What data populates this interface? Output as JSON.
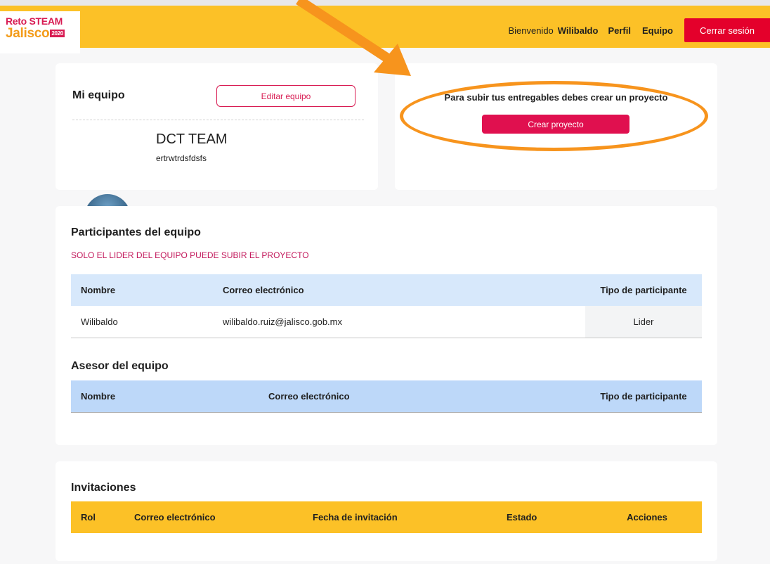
{
  "header": {
    "logo_line1": "Reto STEAM",
    "logo_line2": "Jalisco",
    "logo_year": "2020",
    "welcome_label": "Bienvenido",
    "user_name": "Wilibaldo",
    "nav_profile": "Perfil",
    "nav_team": "Equipo",
    "logout_label": "Cerrar sesión"
  },
  "team_card": {
    "title": "Mi equipo",
    "edit_button": "Editar equipo",
    "team_name": "DCT TEAM",
    "team_description": "ertrwtrdsfdsfs"
  },
  "project_card": {
    "message": "Para subir tus entregables debes crear un proyecto",
    "create_button": "Crear proyecto"
  },
  "participants": {
    "title": "Participantes del equipo",
    "warning": "SOLO EL LIDER DEL EQUIPO PUEDE SUBIR EL PROYECTO",
    "columns": [
      "Nombre",
      "Correo electrónico",
      "Tipo de participante"
    ],
    "rows": [
      {
        "name": "Wilibaldo",
        "email": "wilibaldo.ruiz@jalisco.gob.mx",
        "type": "Lider"
      }
    ]
  },
  "advisor": {
    "title": "Asesor del equipo",
    "columns": [
      "Nombre",
      "Correo electrónico",
      "Tipo de participante"
    ]
  },
  "invitations": {
    "title": "Invitaciones",
    "columns": [
      "Rol",
      "Correo electrónico",
      "Fecha de invitación",
      "Estado",
      "Acciones"
    ]
  },
  "colors": {
    "header_yellow": "#fcc127",
    "brand_pink": "#e0104f",
    "logout_red": "#e4002b",
    "annotation_orange": "#f7941d"
  }
}
